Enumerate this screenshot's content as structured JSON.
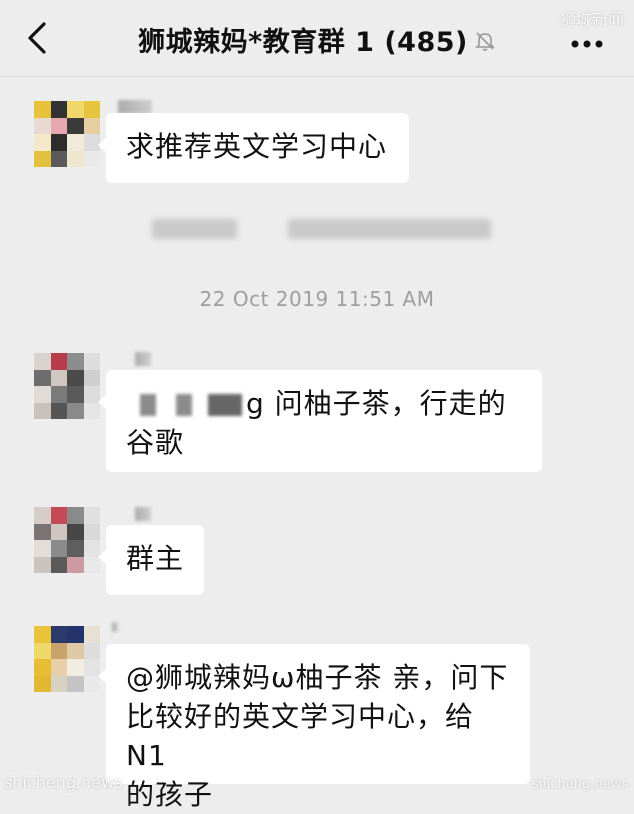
{
  "header": {
    "title": "狮城辣妈*教育群 1 (485)",
    "back_icon": "chevron-left-icon",
    "mute_icon": "bell-off-icon",
    "more_icon": "more-dots-icon"
  },
  "watermark": {
    "top_right": "狮城新闻",
    "bottom_left": "shicheng.news",
    "bottom_right": "shicheng.news"
  },
  "timestamp": "22 Oct 2019 11:51 AM",
  "messages": [
    {
      "text": "求推荐英文学习中心"
    },
    {
      "text_line1": "g 问柚子茶，行走的",
      "text_line2": "谷歌"
    },
    {
      "text": "群主"
    },
    {
      "text_line1": "@狮城辣妈ω柚子茶 亲，问下",
      "text_line2": "比较好的英文学习中心，给N1",
      "text_line3": "的孩子"
    }
  ],
  "colors": {
    "background": "#ededed",
    "bubble": "#ffffff",
    "timestamp": "#9e9e9e"
  }
}
